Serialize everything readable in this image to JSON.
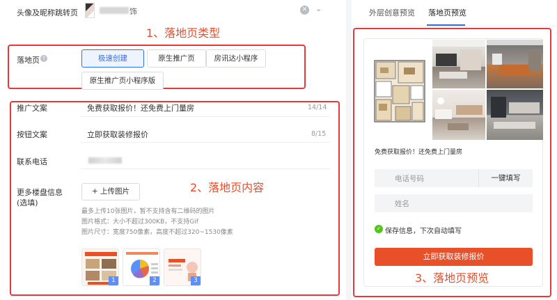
{
  "top": {
    "label": "头像及昵称跳转页",
    "value_tail": "饰"
  },
  "annotations": {
    "a1": "1、落地页类型",
    "a2": "2、落地页内容",
    "a3": "3、落地页预览"
  },
  "landing": {
    "label": "落地页",
    "options": [
      "极速创建",
      "原生推广页",
      "房讯达小程序",
      "原生推广页小程序版"
    ]
  },
  "content": {
    "promo_label": "推广文案",
    "promo_value": "免费获取报价！还免费上门量房",
    "promo_count": "14/14",
    "button_label": "按钮文案",
    "button_value": "立即获取装修报价",
    "button_count": "8/15",
    "phone_label": "联系电话",
    "more_label_1": "更多楼盘信息",
    "more_label_2": "(选填)",
    "upload_label": "+ 上传图片",
    "hint_1": "最多上传10张图片，暂不支持含有二维码的图片",
    "hint_2": "图片格式：大小不超过300KB，不支持Gif",
    "hint_3": "图片尺寸：宽度750像素，高度不超过320~1530像素",
    "images": [
      "1",
      "2",
      "3"
    ]
  },
  "preview": {
    "tab_outer": "外层创意预览",
    "tab_landing": "落地页预览",
    "promo_text": "免费获取报价！还免费上门量房",
    "phone_placeholder": "电话号码",
    "autofill": "一键填写",
    "name_placeholder": "姓名",
    "save_text": "保存信息，下次自动填写",
    "submit": "立即获取装修报价"
  },
  "colors": {
    "accent": "#2a6ff5",
    "annotation": "#e84c2a",
    "submit": "#e8502a",
    "success": "#52c41a"
  }
}
